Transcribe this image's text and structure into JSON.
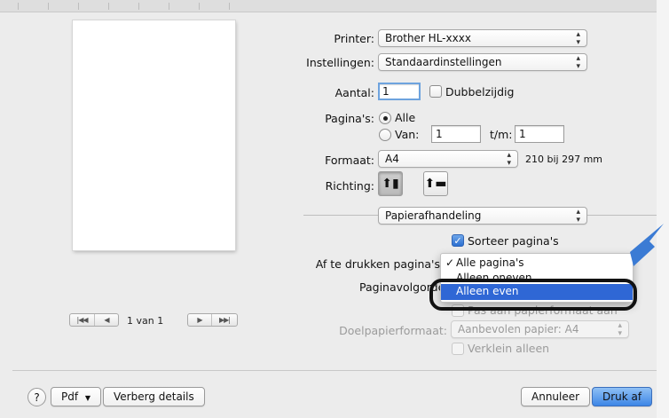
{
  "printer": {
    "label": "Printer:",
    "value": "Brother HL-xxxx"
  },
  "presets": {
    "label": "Instellingen:",
    "value": "Standaardinstellingen"
  },
  "copies": {
    "label": "Aantal:",
    "value": "1",
    "two_sided_label": "Dubbelzijdig"
  },
  "pages": {
    "label": "Pagina's:",
    "all_label": "Alle",
    "from_label": "Van:",
    "from_value": "1",
    "to_label": "t/m:",
    "to_value": "1"
  },
  "paper_size": {
    "label": "Formaat:",
    "value": "A4",
    "dimensions": "210 bij 297 mm"
  },
  "orientation": {
    "label": "Richting:"
  },
  "section": {
    "value": "Papierafhandeling"
  },
  "collate": {
    "label": "Sorteer pagina's",
    "checked": true
  },
  "pages_to_print": {
    "label": "Af te drukken pagina's"
  },
  "page_order": {
    "label": "Paginavolgorde:"
  },
  "scale_to_fit": {
    "label": "Pas aan papierformaat aan"
  },
  "dest_paper": {
    "label": "Doelpapierformaat:",
    "value": "Aanbevolen papier: A4"
  },
  "scale_down_only": {
    "label": "Verklein alleen"
  },
  "menu": {
    "checkmark": "✓",
    "items": [
      {
        "label": "Alle pagina's",
        "checked": true
      },
      {
        "label": "Alleen oneven",
        "checked": false
      },
      {
        "label": "Alleen even",
        "checked": false
      }
    ]
  },
  "preview": {
    "page_label": "1 van 1"
  },
  "bottom": {
    "help": "?",
    "pdf": "Pdf",
    "hide_details": "Verberg details",
    "cancel": "Annuleer",
    "print": "Druk af"
  },
  "colors": {
    "accent": "#2f67d5",
    "annotation_arrow": "#3b7bd4"
  }
}
